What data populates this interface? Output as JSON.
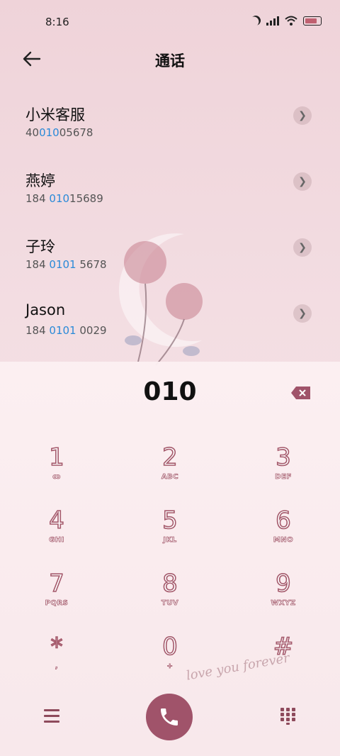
{
  "status_bar": {
    "time": "8:16"
  },
  "header": {
    "title": "通话"
  },
  "contacts": [
    {
      "name": "小米客服",
      "num_pre": "40",
      "num_hl": "010",
      "num_post": "05678"
    },
    {
      "name": "燕婷",
      "num_pre": "184 ",
      "num_hl": "010",
      "num_post": "15689"
    },
    {
      "name": "子玲",
      "num_pre": "184 ",
      "num_hl": "0101",
      "num_post": " 5678"
    },
    {
      "name": "Jason",
      "num_pre": "184 ",
      "num_hl": "0101",
      "num_post": " 0029"
    }
  ],
  "dialer": {
    "entered": "010",
    "keys": [
      {
        "d": "1",
        "l": "ꝏ"
      },
      {
        "d": "2",
        "l": "ABC"
      },
      {
        "d": "3",
        "l": "DEF"
      },
      {
        "d": "4",
        "l": "GHI"
      },
      {
        "d": "5",
        "l": "JKL"
      },
      {
        "d": "6",
        "l": "MNO"
      },
      {
        "d": "7",
        "l": "PQRS"
      },
      {
        "d": "8",
        "l": "TUV"
      },
      {
        "d": "9",
        "l": "WXYZ"
      },
      {
        "d": "*",
        "l": ","
      },
      {
        "d": "0",
        "l": "+"
      },
      {
        "d": "#",
        "l": ""
      }
    ]
  },
  "decor": {
    "text": "love you forever"
  },
  "colors": {
    "accent": "#a0536a",
    "highlight": "#2a8ad8"
  }
}
